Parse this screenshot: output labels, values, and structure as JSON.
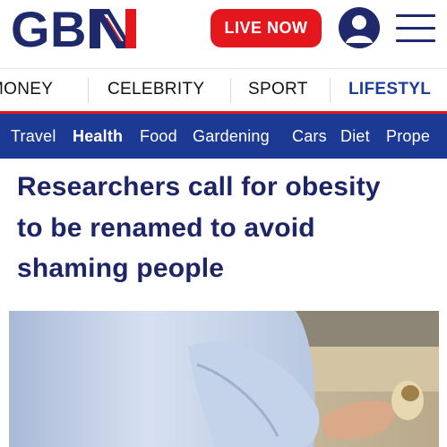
{
  "brand": {
    "logo_text": "GBN",
    "colors": {
      "navy": "#1e2a6b",
      "red": "#e4171d",
      "nav_blue": "#1c3a94",
      "headline": "#1e2566"
    }
  },
  "header": {
    "live_button_label": "LIVE NOW",
    "account_icon": "user-avatar-icon",
    "menu_icon": "hamburger-menu-icon"
  },
  "primary_nav": {
    "items": [
      {
        "label": "MONEY"
      },
      {
        "label": "CELEBRITY"
      },
      {
        "label": "SPORT"
      },
      {
        "label": "LIFESTYL",
        "active": true
      }
    ]
  },
  "secondary_nav": {
    "items": [
      {
        "label": "Travel"
      },
      {
        "label": "Health",
        "active": true
      },
      {
        "label": "Food"
      },
      {
        "label": "Gardening"
      },
      {
        "label": "Cars"
      },
      {
        "label": "Diet"
      },
      {
        "label": "Prope"
      }
    ]
  },
  "article": {
    "headline_lines": [
      "Researchers call for obesity",
      "to be renamed to avoid",
      "shaming people"
    ]
  }
}
